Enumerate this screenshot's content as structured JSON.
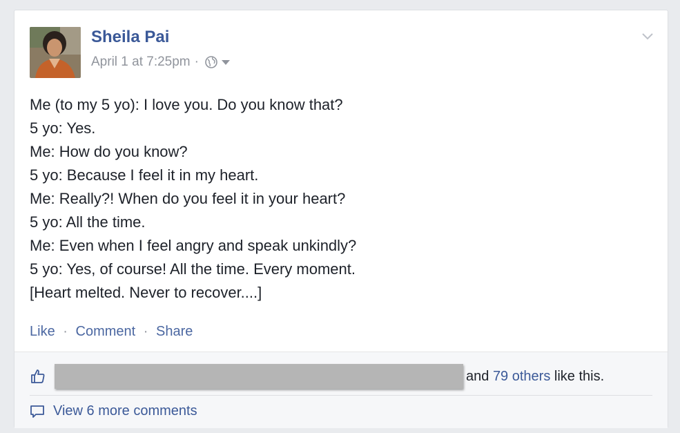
{
  "post": {
    "author": "Sheila Pai",
    "timestamp": "April 1 at 7:25pm",
    "meta_separator": "·",
    "privacy_icon": "globe-icon",
    "lines": [
      "Me (to my 5 yo): I love you. Do you know that?",
      "5 yo: Yes.",
      "Me: How do you know?",
      "5 yo: Because I feel it in my heart.",
      "Me: Really?! When do you feel it in your heart?",
      "5 yo: All the time.",
      "Me: Even when I feel angry and speak unkindly?",
      "5 yo: Yes, of course! All the time. Every moment.",
      "[Heart melted. Never to recover....]"
    ]
  },
  "actions": {
    "like": "Like",
    "comment": "Comment",
    "share": "Share",
    "separator": "·"
  },
  "likes": {
    "prefix": "and",
    "others_link": "79 others",
    "suffix": "like this."
  },
  "comments": {
    "view_more": "View 6 more comments"
  },
  "colors": {
    "link": "#3b5998",
    "meta": "#90949c",
    "text": "#1d2129",
    "footer_bg": "#f6f7f9"
  }
}
